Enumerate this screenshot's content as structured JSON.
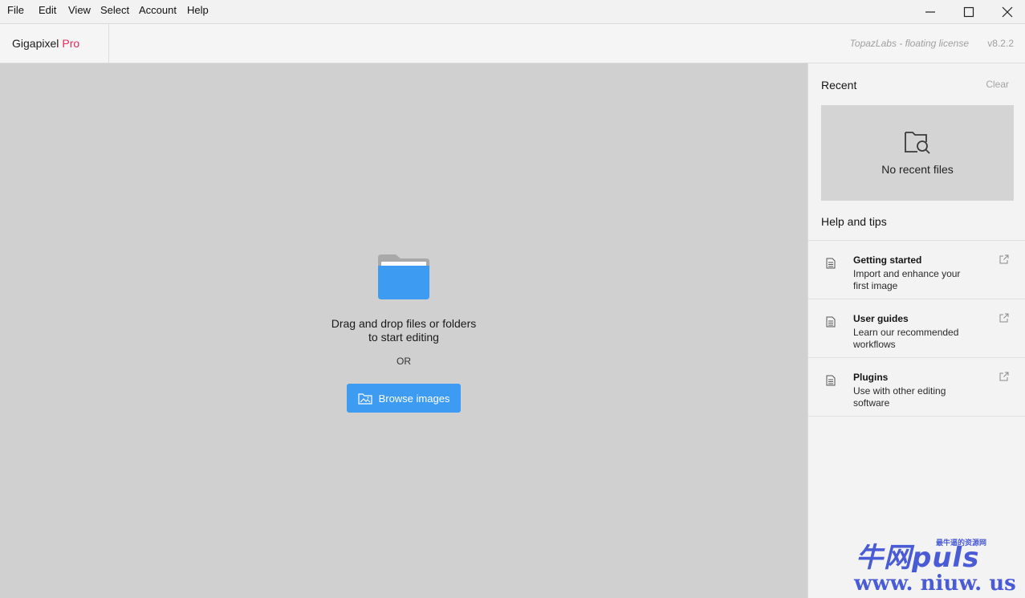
{
  "menu": {
    "file": "File",
    "edit": "Edit",
    "view": "View",
    "select": "Select",
    "account": "Account",
    "help": "Help"
  },
  "header": {
    "app_name": "Gigapixel",
    "edition": "Pro",
    "license": "TopazLabs - floating license",
    "version": "v8.2.2"
  },
  "main": {
    "drop_line1": "Drag and drop files or folders",
    "drop_line2": "to start editing",
    "or": "OR",
    "browse_label": "Browse images"
  },
  "sidebar": {
    "recent_title": "Recent",
    "clear_label": "Clear",
    "no_recent": "No recent files",
    "help_title": "Help and tips",
    "help_items": [
      {
        "title": "Getting started",
        "desc": "Import and enhance your first image"
      },
      {
        "title": "User guides",
        "desc": "Learn our recommended workflows"
      },
      {
        "title": "Plugins",
        "desc": "Use with other editing software"
      }
    ]
  },
  "watermark": {
    "top": "牛网puls",
    "small": "最牛逼的资源网",
    "bottom": "www. niuw. us"
  },
  "colors": {
    "accent": "#3d9bf2",
    "pro": "#e8285c",
    "folder": "#3d9bf2",
    "watermark": "#4a5bd6"
  }
}
